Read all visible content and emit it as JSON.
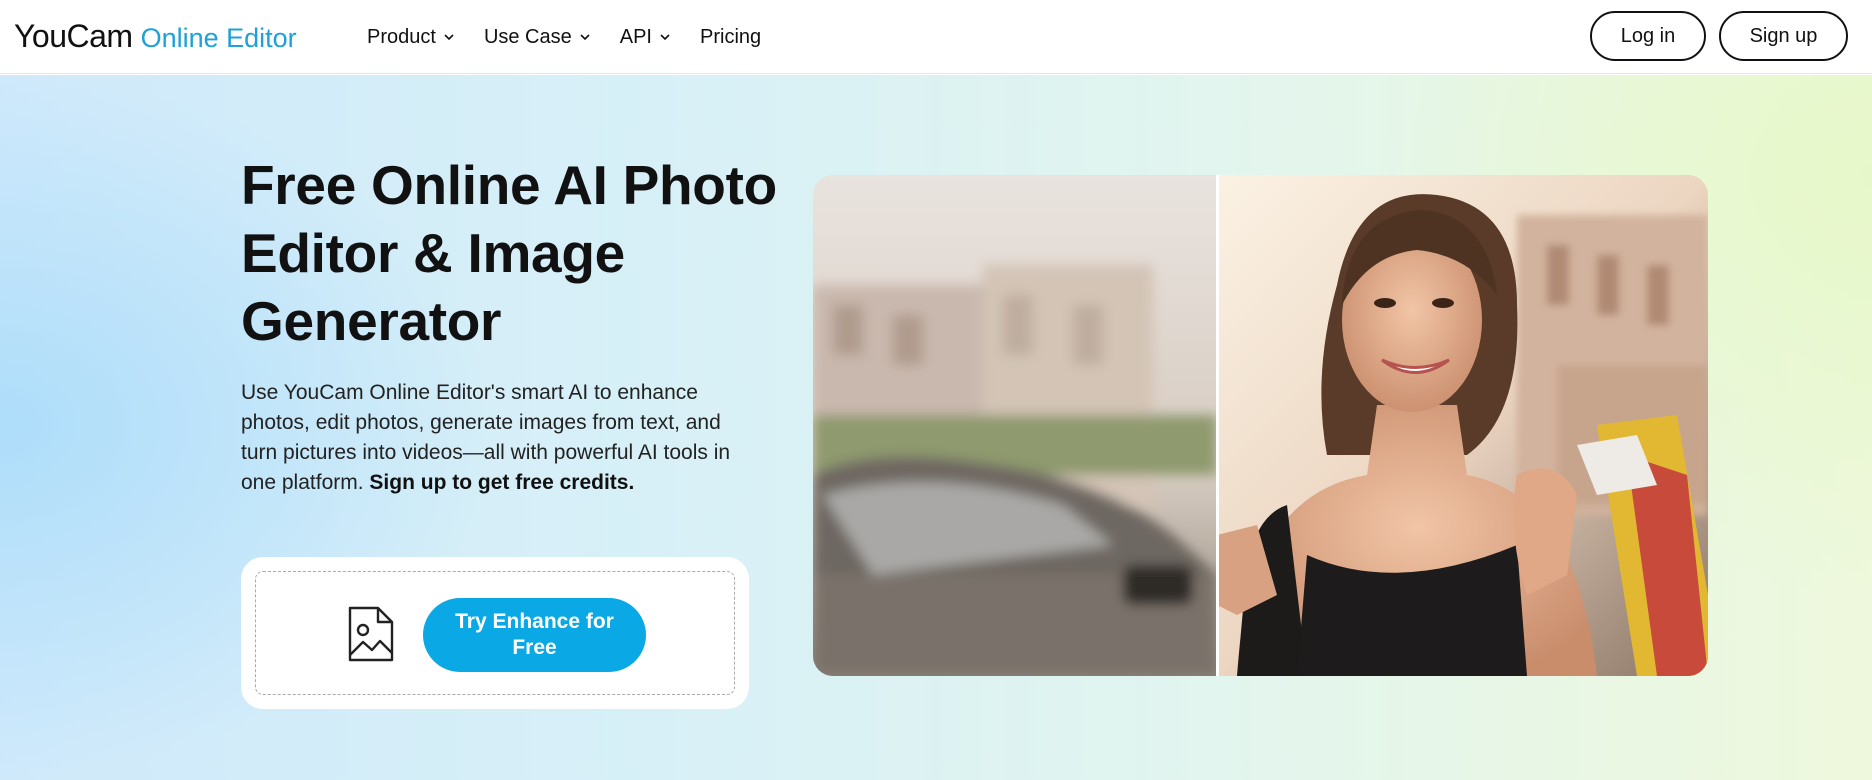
{
  "header": {
    "logo_main": "YouCam",
    "logo_sub": "Online Editor",
    "nav": [
      {
        "label": "Product",
        "has_dropdown": true
      },
      {
        "label": "Use Case",
        "has_dropdown": true
      },
      {
        "label": "API",
        "has_dropdown": true
      },
      {
        "label": "Pricing",
        "has_dropdown": false
      }
    ],
    "login_label": "Log in",
    "signup_label": "Sign up"
  },
  "hero": {
    "title": "Free Online AI Photo Editor & Image Generator",
    "description": "Use YouCam Online Editor's smart AI to enhance photos, edit photos, generate images from text, and turn pictures into videos—all with powerful AI tools in one platform.",
    "description_cta": "Sign up to get free credits.",
    "upload_icon": "image-file-icon",
    "try_button_label": "Try Enhance for Free"
  },
  "colors": {
    "brand": "#1ea1d8",
    "button": "#0aa8e4",
    "text": "#111111"
  }
}
